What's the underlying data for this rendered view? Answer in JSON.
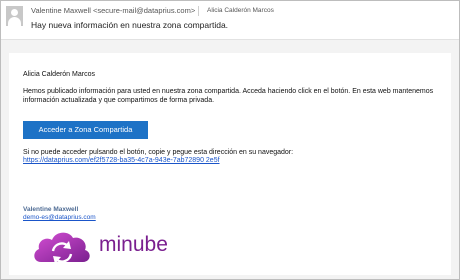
{
  "email": {
    "from": "Valentine Maxwell <secure-mail@dataprius.com>",
    "to": "Alicia Calderón Marcos",
    "subject": "Hay nueva información en nuestra zona compartida."
  },
  "body": {
    "greeting": "Alicia Calderón Marcos",
    "paragraph_line1": "Hemos publicado información para usted en nuestra zona compartida. Acceda haciendo click en el botón. En esta web mantenemos",
    "paragraph_line2": "información actualizada y que compartimos de forma privada.",
    "button_label": "Acceder a Zona Compartida",
    "fallback_text": "Si no puede acceder pulsando el botón, copie y pegue esta dirección en su navegador:",
    "url": "https://dataprius.com/ef2f5728-ba35-4c7a-943e-7ab72890 2e5f"
  },
  "signature": {
    "name": "Valentine Maxwell",
    "email": "demo-es@dataprius.com",
    "logo_text": "minube",
    "logo_icon": "cloud-sync-icon"
  },
  "colors": {
    "button": "#1d72c6",
    "link": "#1a55c9",
    "logo": "#7a1f8f"
  }
}
